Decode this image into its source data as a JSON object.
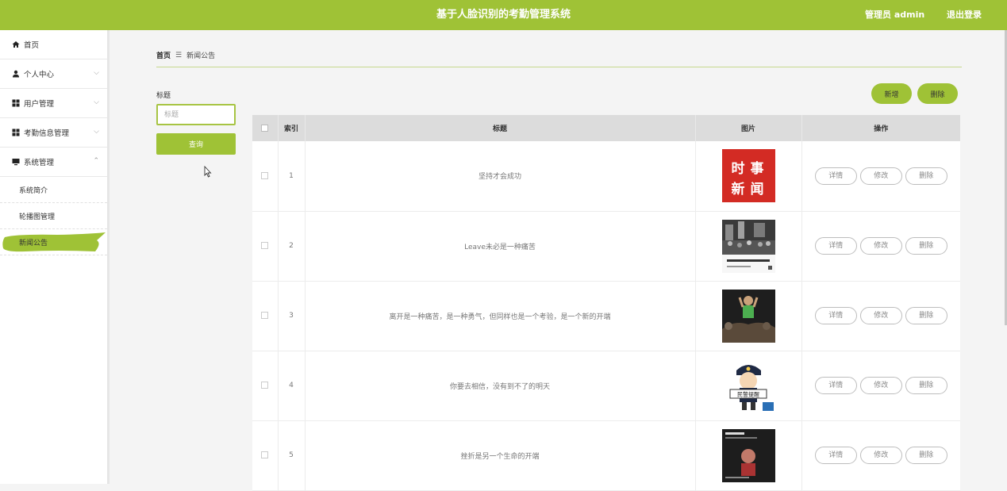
{
  "header": {
    "title": "基于人脸识别的考勤管理系统",
    "user": "管理员 admin",
    "logout": "退出登录"
  },
  "sidebar": {
    "items": [
      {
        "label": "首页",
        "icon": "home-icon"
      },
      {
        "label": "个人中心",
        "icon": "user-icon"
      },
      {
        "label": "用户管理",
        "icon": "grid-icon"
      },
      {
        "label": "考勤信息管理",
        "icon": "grid-icon"
      },
      {
        "label": "系统管理",
        "icon": "monitor-icon"
      }
    ],
    "sub_items": [
      {
        "label": "系统简介"
      },
      {
        "label": "轮播图管理"
      },
      {
        "label": "新闻公告",
        "active": true
      }
    ],
    "accent_color": "#9fc236"
  },
  "breadcrumb": {
    "home": "首页",
    "current": "新闻公告"
  },
  "search": {
    "label": "标题",
    "placeholder": "标题",
    "button": "查询"
  },
  "actions": {
    "add": "新增",
    "delete": "删除"
  },
  "table": {
    "headers": [
      "索引",
      "标题",
      "图片",
      "操作"
    ],
    "rows": [
      {
        "index": "1",
        "title": "坚持才会成功",
        "image": "news-image-red"
      },
      {
        "index": "2",
        "title": "Leave未必是一种痛苦",
        "image": "crowd-photo"
      },
      {
        "index": "3",
        "title": "离开是一种痛苦，是一种勇气，但同样也是一个考验，是一个新的开端",
        "image": "concert-photo"
      },
      {
        "index": "4",
        "title": "你要去相信，没有到不了的明天",
        "image": "police-cartoon"
      },
      {
        "index": "5",
        "title": "挫折是另一个生命的开端",
        "image": "dark-poster"
      }
    ],
    "row_buttons": {
      "detail": "详情",
      "edit": "修改",
      "delete": "删除"
    }
  },
  "thumb_text": {
    "news": [
      "时",
      "事",
      "新",
      "闻"
    ],
    "police": "民警提醒"
  }
}
